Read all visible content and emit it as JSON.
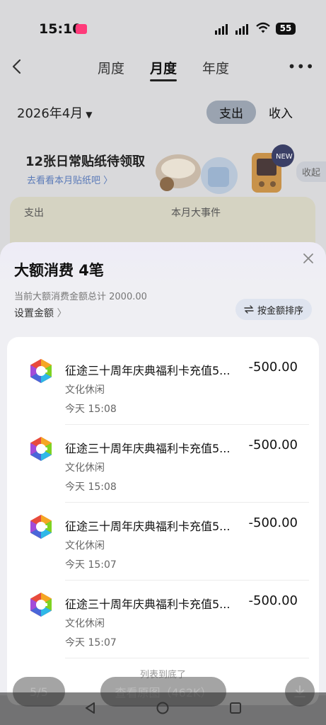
{
  "status_bar": {
    "time": "15:10",
    "battery": "55"
  },
  "header": {
    "tabs": [
      {
        "label": "周度",
        "active": false
      },
      {
        "label": "月度",
        "active": true
      },
      {
        "label": "年度",
        "active": false
      }
    ],
    "more_label": "•••"
  },
  "filter": {
    "date": "2026年4月",
    "type_active": "支出",
    "type_inactive": "收入"
  },
  "sticker_banner": {
    "title": "12张日常贴纸待领取",
    "subtitle": "去看看本月贴纸吧 〉",
    "collapse_label": "收起",
    "badge": "NEW"
  },
  "summary_card": {
    "left_label": "支出",
    "right_label": "本月大事件"
  },
  "sheet": {
    "title": "大额消费 4笔",
    "total_text": "当前大额消费金额总计 2000.00",
    "setting_label": "设置金额",
    "sort_label": "按金额排序",
    "items": [
      {
        "name": "征途三十周年庆典福利卡充值5...",
        "amount": "-500.00",
        "category": "文化休闲",
        "time": "今天 15:08"
      },
      {
        "name": "征途三十周年庆典福利卡充值5...",
        "amount": "-500.00",
        "category": "文化休闲",
        "time": "今天 15:08"
      },
      {
        "name": "征途三十周年庆典福利卡充值5...",
        "amount": "-500.00",
        "category": "文化休闲",
        "time": "今天 15:07"
      },
      {
        "name": "征途三十周年庆典福利卡充值5...",
        "amount": "-500.00",
        "category": "文化休闲",
        "time": "今天 15:07"
      }
    ],
    "end_text": "列表到底了"
  },
  "viewer": {
    "count": "5/5",
    "original_label": "查看原图（462K）"
  },
  "colors": {
    "accent": "#9aa3b0",
    "card": "#d5d3c2",
    "sort_button": "#dfe4ef",
    "link": "#5a7ab8"
  }
}
